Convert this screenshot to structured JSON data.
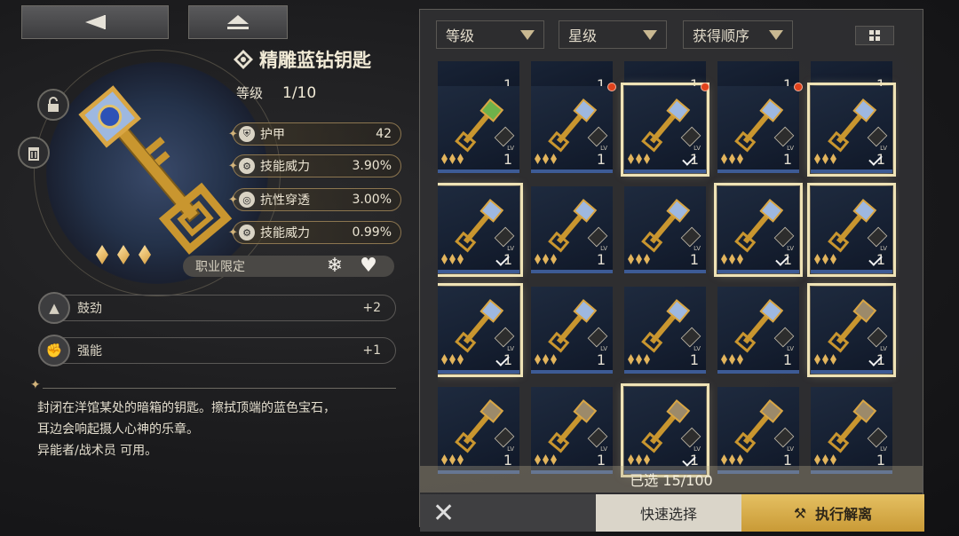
{
  "nav": {
    "back_icon": "back-arrow-icon",
    "home_icon": "eject-home-icon"
  },
  "item": {
    "name": "精雕蓝钻钥匙",
    "level_label": "等级",
    "level_value": "1/10",
    "stars": 3
  },
  "stats": [
    {
      "name": "护甲",
      "value": "42",
      "icon": "shield-icon"
    },
    {
      "name": "技能威力",
      "value": "3.90%",
      "icon": "gear-icon"
    },
    {
      "name": "抗性穿透",
      "value": "3.00%",
      "icon": "swirl-icon"
    },
    {
      "name": "技能威力",
      "value": "0.99%",
      "icon": "gear-icon"
    }
  ],
  "job_limit": {
    "label": "职业限定",
    "icons": [
      "snowflake-icon",
      "heart-icon"
    ]
  },
  "skills": [
    {
      "name": "鼓劲",
      "bonus": "+2",
      "icon": "pyramid-icon"
    },
    {
      "name": "强能",
      "bonus": "+1",
      "icon": "fist-icon"
    }
  ],
  "description": [
    "封闭在洋馆某处的暗箱的钥匙。擦拭顶端的蓝色宝石，",
    "耳边会响起摄人心神的乐章。",
    "异能者/战术员 可用。"
  ],
  "filters": {
    "level": "等级",
    "star": "星级",
    "order": "获得顺序"
  },
  "grid": {
    "cards": [
      {
        "row": 0,
        "col": 0,
        "selected": false,
        "type": "vine",
        "dot": false
      },
      {
        "row": 0,
        "col": 1,
        "selected": false,
        "type": "blue",
        "dot": true
      },
      {
        "row": 0,
        "col": 2,
        "selected": true,
        "type": "blue",
        "dot": true
      },
      {
        "row": 0,
        "col": 3,
        "selected": false,
        "type": "blue",
        "dot": true
      },
      {
        "row": 0,
        "col": 4,
        "selected": true,
        "type": "blue",
        "dot": false
      },
      {
        "row": 1,
        "col": 0,
        "selected": true,
        "type": "blue",
        "dot": false
      },
      {
        "row": 1,
        "col": 1,
        "selected": false,
        "type": "blue",
        "dot": false
      },
      {
        "row": 1,
        "col": 2,
        "selected": false,
        "type": "blue",
        "dot": false
      },
      {
        "row": 1,
        "col": 3,
        "selected": true,
        "type": "blue",
        "dot": false
      },
      {
        "row": 1,
        "col": 4,
        "selected": true,
        "type": "blue",
        "dot": false
      },
      {
        "row": 2,
        "col": 0,
        "selected": true,
        "type": "blue",
        "dot": false
      },
      {
        "row": 2,
        "col": 1,
        "selected": false,
        "type": "blue",
        "dot": false
      },
      {
        "row": 2,
        "col": 2,
        "selected": false,
        "type": "blue",
        "dot": false
      },
      {
        "row": 2,
        "col": 3,
        "selected": false,
        "type": "blue",
        "dot": false
      },
      {
        "row": 2,
        "col": 4,
        "selected": true,
        "type": "bronze",
        "dot": false
      },
      {
        "row": 3,
        "col": 0,
        "selected": false,
        "type": "bronze",
        "dot": false
      },
      {
        "row": 3,
        "col": 1,
        "selected": false,
        "type": "bronze",
        "dot": false
      },
      {
        "row": 3,
        "col": 2,
        "selected": true,
        "type": "bronze",
        "dot": false
      },
      {
        "row": 3,
        "col": 3,
        "selected": false,
        "type": "bronze",
        "dot": false
      },
      {
        "row": 3,
        "col": 4,
        "selected": false,
        "type": "bronze",
        "dot": false
      }
    ],
    "card_level_label": "LV",
    "card_number": "1"
  },
  "selection": {
    "text": "已选 15/100"
  },
  "buttons": {
    "quick_select": "快速选择",
    "execute": "执行解离"
  },
  "colors": {
    "gold_button": "#d8b04c",
    "selected_outline": "#efe3b6",
    "badge_red": "#e0421c"
  }
}
